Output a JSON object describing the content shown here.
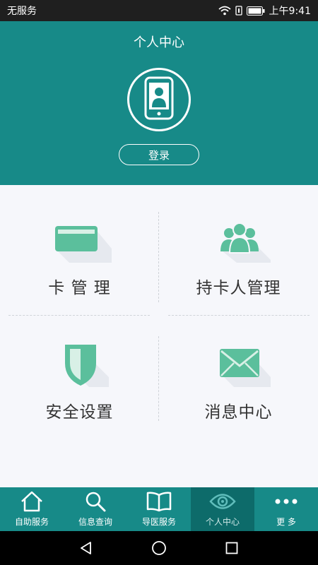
{
  "status_bar": {
    "carrier": "无服务",
    "time": "上午9:41"
  },
  "header": {
    "title": "个人中心",
    "login_label": "登录"
  },
  "tiles": {
    "card": {
      "label": "卡 管 理"
    },
    "holder": {
      "label": "持卡人管理"
    },
    "security": {
      "label": "安全设置"
    },
    "message": {
      "label": "消息中心"
    }
  },
  "bottom_nav": {
    "items": [
      {
        "label": "自助服务",
        "icon": "home-icon"
      },
      {
        "label": "信息查询",
        "icon": "search-icon"
      },
      {
        "label": "导医服务",
        "icon": "book-icon"
      },
      {
        "label": "个人中心",
        "icon": "eye-icon",
        "active": true
      },
      {
        "label": "更 多",
        "icon": "more-icon"
      }
    ]
  },
  "colors": {
    "primary": "#178a88",
    "primary_dark": "#0d6b6a",
    "icon_green": "#5bbf9c"
  }
}
